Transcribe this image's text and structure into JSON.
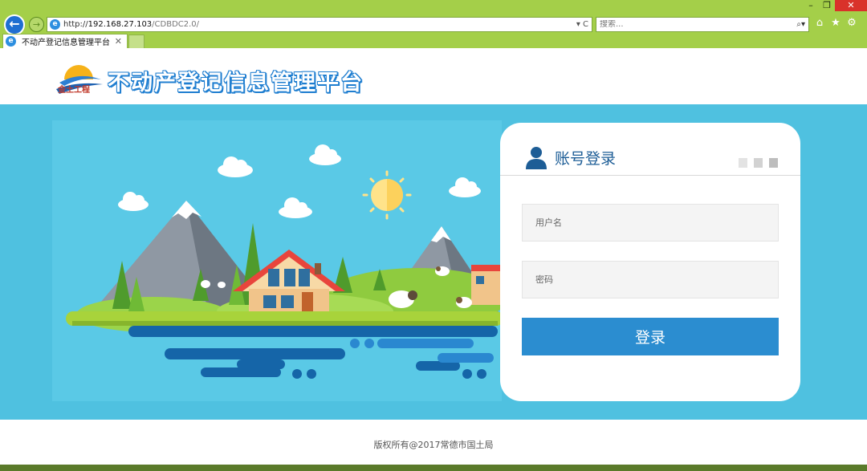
{
  "browser": {
    "url_prefix": "http://",
    "url_host": "192.168.27.103",
    "url_path": "/CDBDC2.0/",
    "url_tools": "▾ C",
    "search_placeholder": "搜索...",
    "tab_title": "不动产登记信息管理平台",
    "window_controls": {
      "minimize": "–",
      "restore": "❐",
      "close": "✕"
    },
    "toolbar_icons": [
      "home-icon",
      "favorites-star-icon",
      "settings-gear-icon"
    ],
    "colors": {
      "chrome": "#a4cf49",
      "back_button": "#1f6fd1",
      "close_button": "#d9322a"
    }
  },
  "header": {
    "logo_text": "金土工程",
    "site_title": "不动产登记信息管理平台",
    "title_color": "#1f7ed0"
  },
  "login": {
    "title": "账号登录",
    "username_placeholder": "用户名",
    "password_placeholder": "密码",
    "submit_label": "登录",
    "colors": {
      "title": "#1d5d96",
      "button": "#2b8dd0"
    }
  },
  "banner": {
    "background": "#4fc1e0"
  },
  "footer": {
    "copyright": "版权所有@2017常德市国土局"
  }
}
